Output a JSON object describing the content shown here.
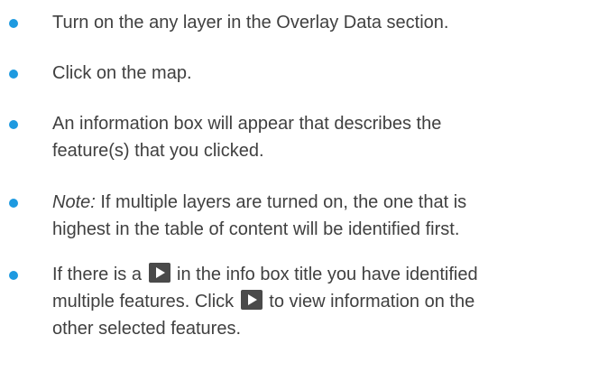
{
  "bullets": {
    "item1": "Turn on the any layer in the Overlay Data section.",
    "item2": "Click on the map.",
    "item3": {
      "line1": "An information box will appear that describes the",
      "line2": "feature(s) that you clicked."
    },
    "item4": {
      "note_label": "Note:",
      "line1_rest": " If multiple layers are turned on, the one that is",
      "line2": "highest in the table of content will be identified first."
    },
    "item5": {
      "part1": "If there is a ",
      "part2": " in the info box title you have identified",
      "part3": "multiple features. Click ",
      "part4": " to view information on the",
      "line3": "other selected features."
    }
  },
  "icons": {
    "bullet": "bullet-dot",
    "play": "play-triangle-icon",
    "accent_color": "#1e9ae0",
    "icon_bg_color": "#4a4a4a",
    "text_color": "#404040"
  }
}
